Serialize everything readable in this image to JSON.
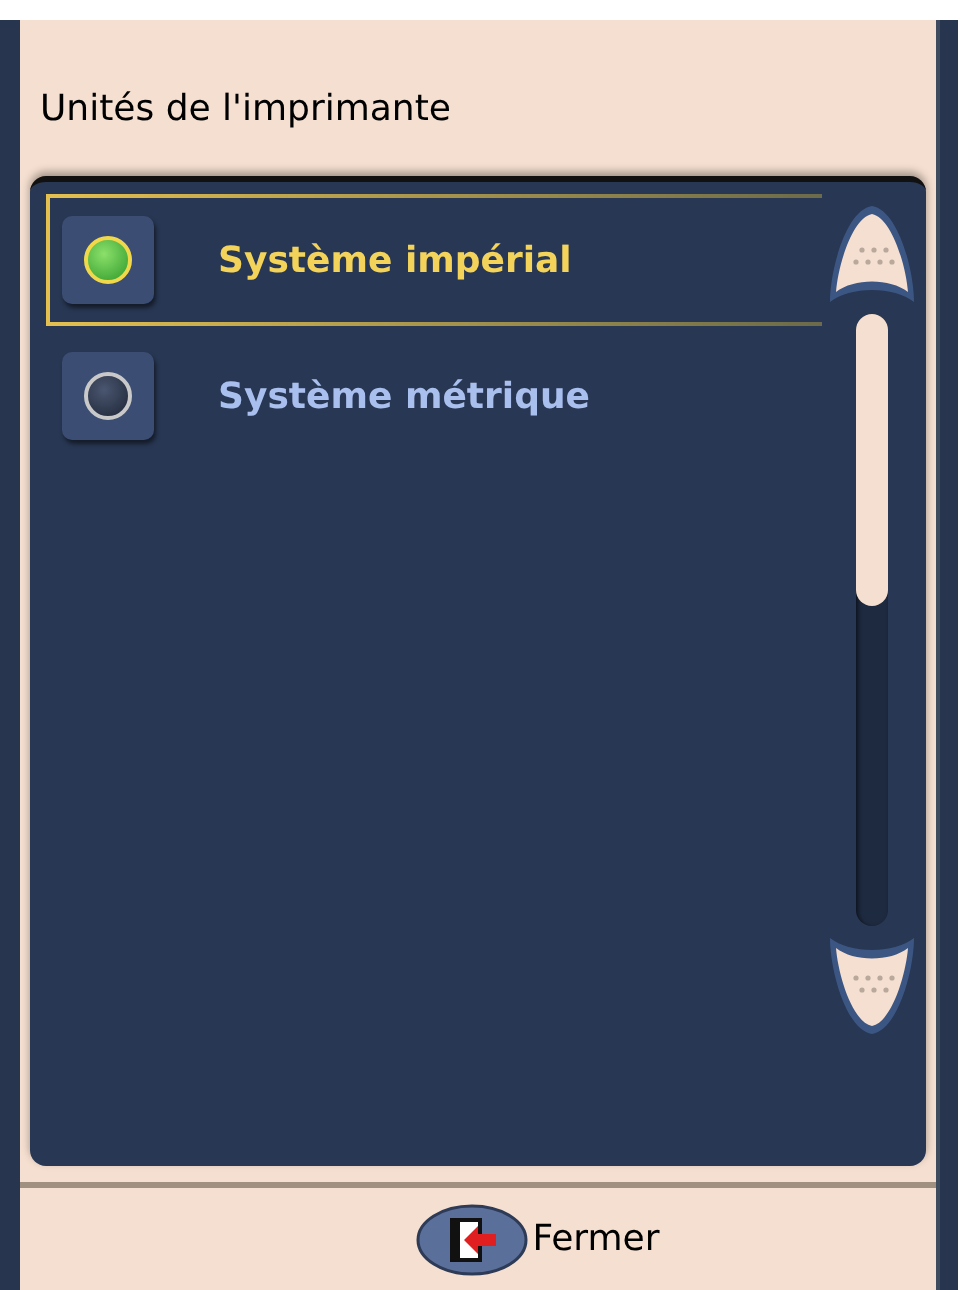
{
  "title": "Unités de l'imprimante",
  "options": [
    {
      "label": "Système impérial",
      "selected": true
    },
    {
      "label": "Système métrique",
      "selected": false
    }
  ],
  "close_button": {
    "label": "Fermer"
  }
}
